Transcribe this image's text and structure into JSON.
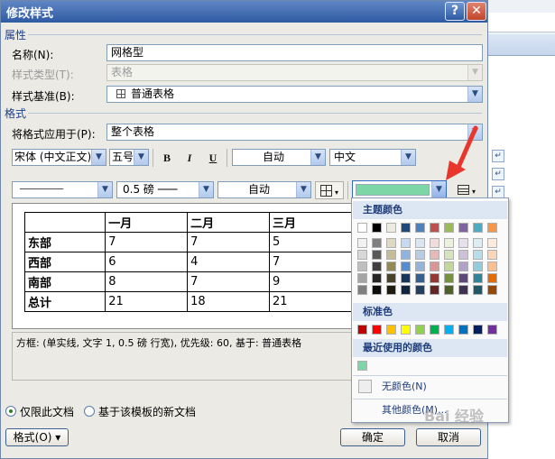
{
  "dialog": {
    "title": "修改样式",
    "help_label": "?",
    "close_label": "✕"
  },
  "sections": {
    "properties": "属性",
    "format": "格式"
  },
  "props": {
    "name_label": "名称(N):",
    "name_value": "网格型",
    "type_label": "样式类型(T):",
    "type_value": "表格",
    "base_label": "样式基准(B):",
    "base_value": "普通表格",
    "base_icon": "table-icon"
  },
  "format": {
    "apply_label": "将格式应用于(P):",
    "apply_value": "整个表格",
    "font_value": "宋体 (中文正文)",
    "size_value": "五号",
    "bold_label": "B",
    "italic_label": "I",
    "underline_label": "U",
    "color_value": "自动",
    "lang_value": "中文",
    "line_style_value": "────────",
    "line_width_value": "0.5 磅 ───",
    "border_color_value": "自动",
    "shading_color": "#7dd6a6"
  },
  "preview": {
    "headers": [
      "",
      "一月",
      "二月",
      "三月"
    ],
    "rows": [
      [
        "东部",
        "7",
        "7",
        "5"
      ],
      [
        "西部",
        "6",
        "4",
        "7"
      ],
      [
        "南部",
        "8",
        "7",
        "9"
      ],
      [
        "总计",
        "21",
        "18",
        "21"
      ]
    ]
  },
  "description": "方框: (单实线, 文字 1, 0.5 磅 行宽), 优先级: 60, 基于: 普通表格",
  "options": {
    "only_this_doc": "仅限此文档",
    "new_from_template": "基于该模板的新文档"
  },
  "buttons": {
    "format": "格式(O) ▾",
    "ok": "确定",
    "cancel": "取消"
  },
  "color_popup": {
    "theme_colors_label": "主题颜色",
    "standard_colors_label": "标准色",
    "recent_colors_label": "最近使用的颜色",
    "no_color_label": "无颜色(N)",
    "more_colors_label": "其他颜色(M)...",
    "theme_top": [
      "#ffffff",
      "#000000",
      "#eeece1",
      "#1f497d",
      "#4f81bd",
      "#c0504d",
      "#9bbb59",
      "#8064a2",
      "#4bacc6",
      "#f79646"
    ],
    "theme_shades": [
      [
        "#f2f2f2",
        "#d8d8d8",
        "#bfbfbf",
        "#a5a5a5",
        "#7f7f7f"
      ],
      [
        "#7f7f7f",
        "#595959",
        "#3f3f3f",
        "#262626",
        "#0c0c0c"
      ],
      [
        "#ddd9c3",
        "#c4bd97",
        "#938953",
        "#494429",
        "#1d1b10"
      ],
      [
        "#c6d9f0",
        "#8db3e2",
        "#548dd4",
        "#17365d",
        "#0f243e"
      ],
      [
        "#dbe5f1",
        "#b8cce4",
        "#95b3d7",
        "#366092",
        "#244061"
      ],
      [
        "#f2dcdb",
        "#e5b9b7",
        "#d99694",
        "#953734",
        "#632423"
      ],
      [
        "#ebf1dd",
        "#d7e3bc",
        "#c3d69b",
        "#76923c",
        "#4f6128"
      ],
      [
        "#e5e0ec",
        "#ccc1d9",
        "#b2a2c7",
        "#5f497a",
        "#3f3151"
      ],
      [
        "#dbeef3",
        "#b7dde8",
        "#92cddc",
        "#31859b",
        "#205867"
      ],
      [
        "#fdeada",
        "#fbd5b5",
        "#fac08f",
        "#e36c09",
        "#974806"
      ]
    ],
    "standard": [
      "#c00000",
      "#ff0000",
      "#ffc000",
      "#ffff00",
      "#92d050",
      "#00b050",
      "#00b0f0",
      "#0070c0",
      "#002060",
      "#7030a0"
    ],
    "recent": [
      "#7dd6a6"
    ]
  },
  "watermark": "Bai 经验"
}
